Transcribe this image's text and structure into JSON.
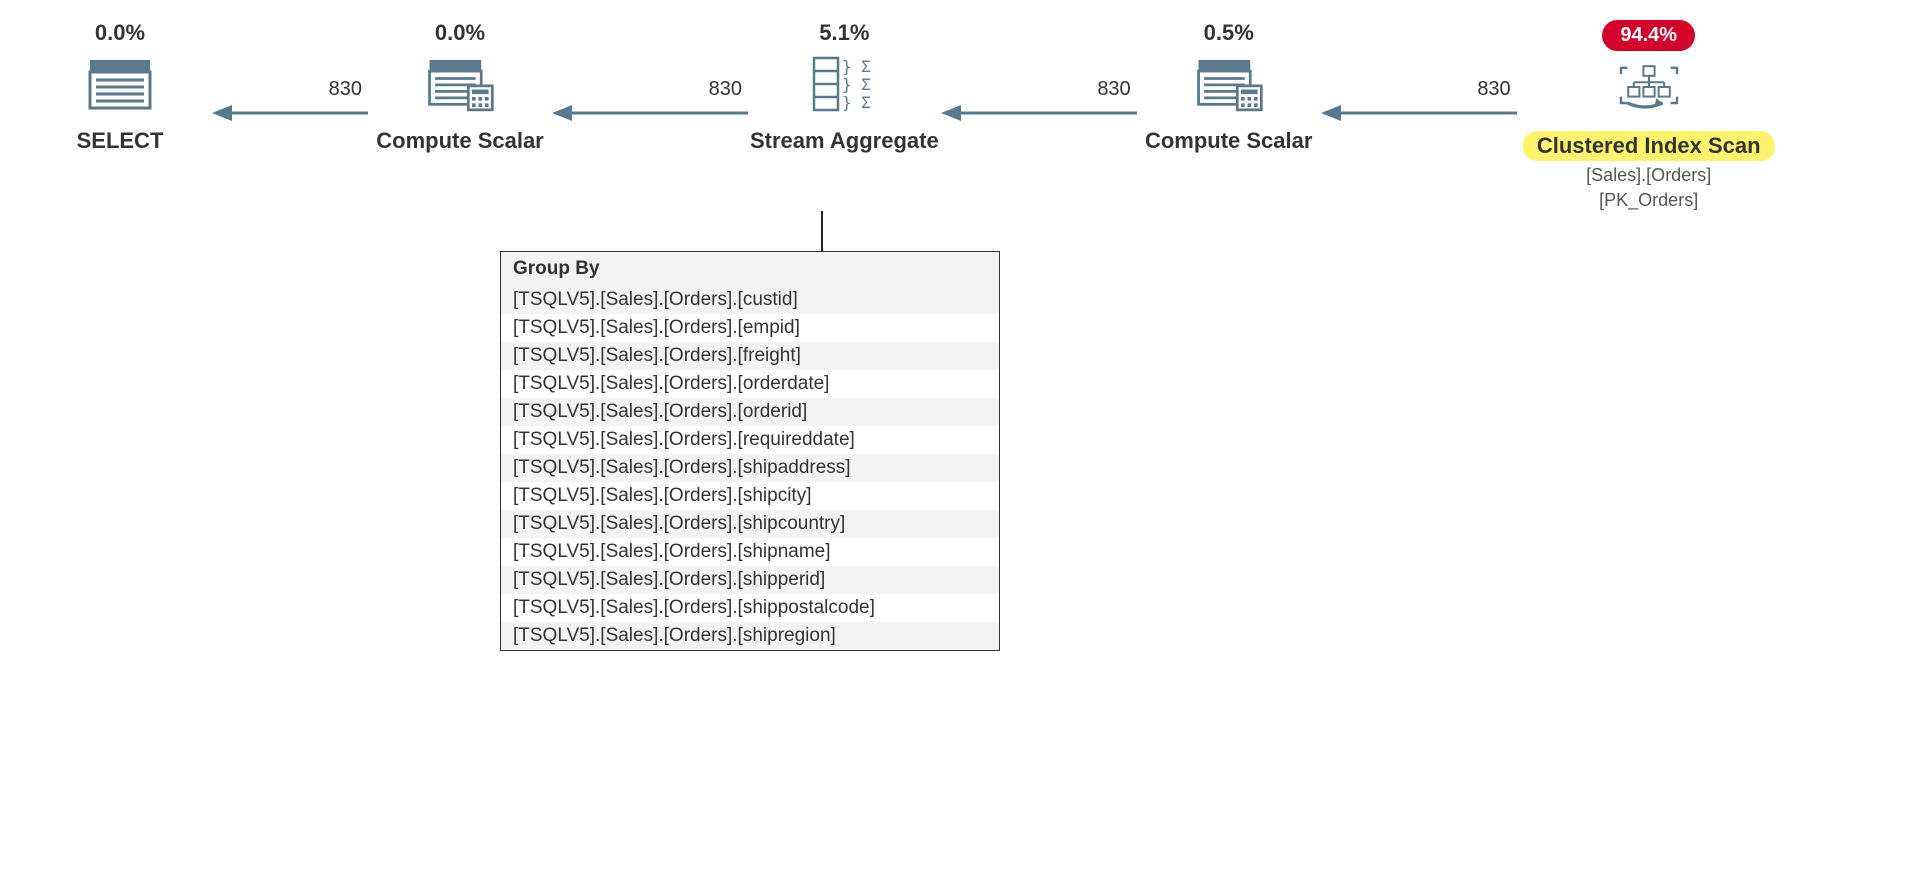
{
  "nodes": [
    {
      "id": "select",
      "cost": "0.0%",
      "label": "SELECT"
    },
    {
      "id": "compute1",
      "cost": "0.0%",
      "label": "Compute Scalar"
    },
    {
      "id": "streamagg",
      "cost": "5.1%",
      "label": "Stream Aggregate"
    },
    {
      "id": "compute2",
      "cost": "0.5%",
      "label": "Compute Scalar"
    },
    {
      "id": "cis",
      "cost": "94.4%",
      "label": "Clustered Index Scan",
      "sub1": "[Sales].[Orders]",
      "sub2": "[PK_Orders]"
    }
  ],
  "arrows": [
    {
      "count": "830"
    },
    {
      "count": "830"
    },
    {
      "count": "830"
    },
    {
      "count": "830"
    }
  ],
  "detail": {
    "header": "Group By",
    "rows": [
      "[TSQLV5].[Sales].[Orders].[custid]",
      "[TSQLV5].[Sales].[Orders].[empid]",
      "[TSQLV5].[Sales].[Orders].[freight]",
      "[TSQLV5].[Sales].[Orders].[orderdate]",
      "[TSQLV5].[Sales].[Orders].[orderid]",
      "[TSQLV5].[Sales].[Orders].[requireddate]",
      "[TSQLV5].[Sales].[Orders].[shipaddress]",
      "[TSQLV5].[Sales].[Orders].[shipcity]",
      "[TSQLV5].[Sales].[Orders].[shipcountry]",
      "[TSQLV5].[Sales].[Orders].[shipname]",
      "[TSQLV5].[Sales].[Orders].[shipperid]",
      "[TSQLV5].[Sales].[Orders].[shippostalcode]",
      "[TSQLV5].[Sales].[Orders].[shipregion]"
    ]
  }
}
